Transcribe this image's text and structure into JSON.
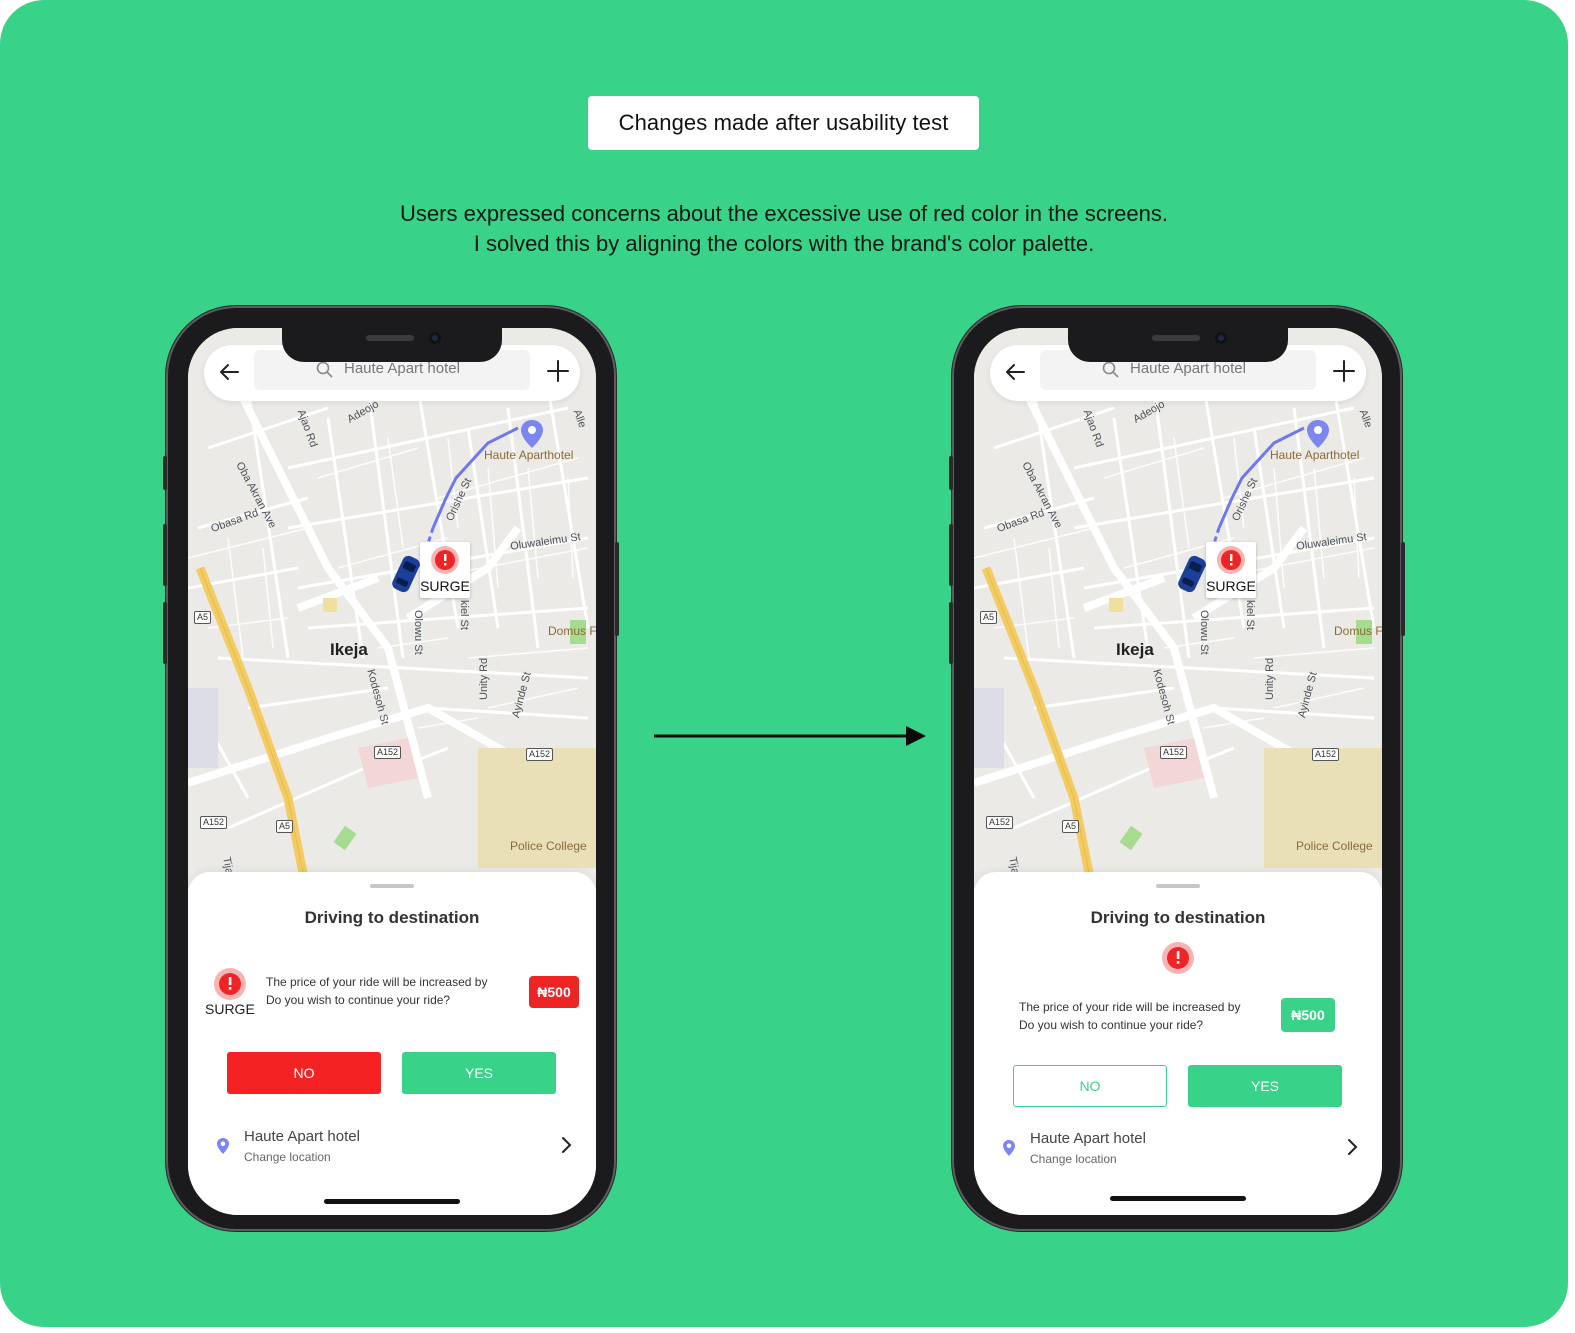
{
  "header": {
    "tag": "Changes made after usability test",
    "description_line1": "Users expressed concerns about the excessive use of red color in the screens.",
    "description_line2": "I solved this by aligning the colors with the brand's color palette."
  },
  "colors": {
    "background": "#38d388",
    "brand_green": "#38d388",
    "alert_red": "#ef2424",
    "route_blue": "#7b86f0"
  },
  "map": {
    "labels": {
      "destination_poi": "Haute Aparthotel",
      "area": "Ikeja",
      "road1": "Oba Akran Ave",
      "road2": "Obasa Rd",
      "road3": "Ajao Rd",
      "road4": "Adeojo",
      "road5": "Orishe St",
      "road6": "Oluwaleimu St",
      "road7": "Olowu St",
      "road8": "kiel St",
      "road9": "Kodesoh St",
      "road10": "Unity Rd",
      "road11": "Ayinde St",
      "poi2": "Domus F",
      "poi3": "Police College",
      "shield_a5": "A5",
      "shield_a152": "A152",
      "edge1": "Alle",
      "edge2": "Tija"
    },
    "surge_label": "SURGE",
    "car_icon": "car-icon",
    "pin_icon": "location-pin-icon"
  },
  "before": {
    "search": {
      "value": "Haute Apart hotel"
    },
    "sheet": {
      "title": "Driving to destination",
      "surge_label": "SURGE",
      "message_line1": "The price of your ride will be increased by",
      "message_line2": "Do you wish to continue your ride?",
      "price": "₦500",
      "no_label": "NO",
      "yes_label": "YES",
      "location_title": "Haute Apart hotel",
      "location_sub": "Change location"
    }
  },
  "after": {
    "search": {
      "value": "Haute Apart hotel"
    },
    "sheet": {
      "title": "Driving to destination",
      "message_line1": "The price of your ride will be increased by",
      "message_line2": "Do you wish to continue your ride?",
      "price": "₦500",
      "no_label": "NO",
      "yes_label": "YES",
      "location_title": "Haute Apart hotel",
      "location_sub": "Change location"
    }
  }
}
